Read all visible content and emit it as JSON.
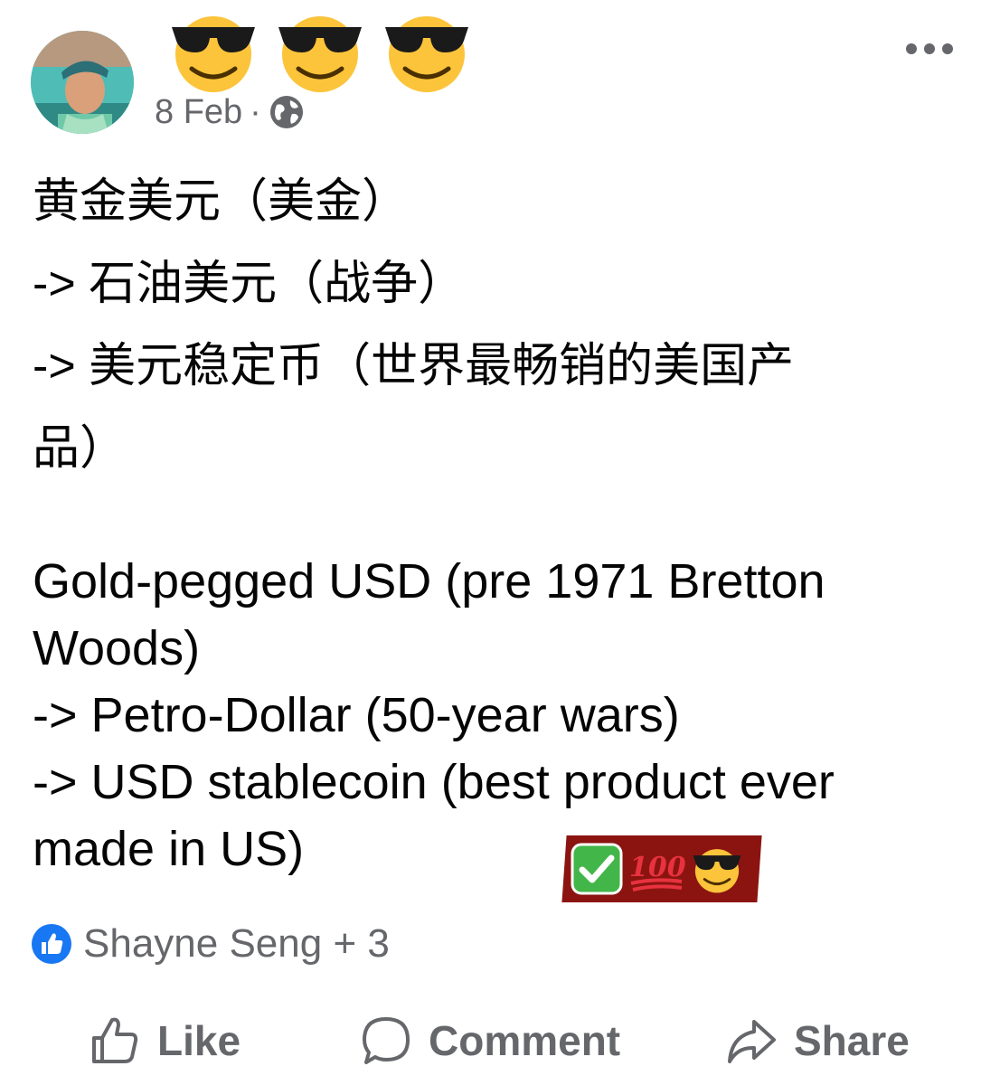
{
  "post": {
    "date": "8 Feb",
    "separator": "·",
    "privacy_icon": "globe-icon",
    "name_cover_icon": "smiling-face-with-sunglasses-icon",
    "more_icon": "more-dots-icon"
  },
  "content": {
    "cn_lines": [
      "黄金美元（美金）",
      "-> 石油美元（战争）",
      "-> 美元稳定币（世界最畅销的美国产",
      "品）"
    ],
    "en_lines": [
      "Gold-pegged USD (pre 1971 Bretton",
      "Woods)",
      "-> Petro-Dollar (50-year wars)",
      "-> USD stablecoin (best product ever",
      "made in US)"
    ],
    "sticker_icons": [
      "check-mark-button-icon",
      "hundred-points-icon",
      "smiling-face-with-sunglasses-icon"
    ],
    "sticker_hundred_text": "100"
  },
  "reactions": {
    "icon": "like-badge-icon",
    "text": "Shayne Seng + 3"
  },
  "actions": {
    "like": "Like",
    "comment": "Comment",
    "share": "Share"
  },
  "colors": {
    "secondary_text": "#65676b",
    "like_blue": "#1877f2",
    "sticker_bg": "#8b1410"
  }
}
